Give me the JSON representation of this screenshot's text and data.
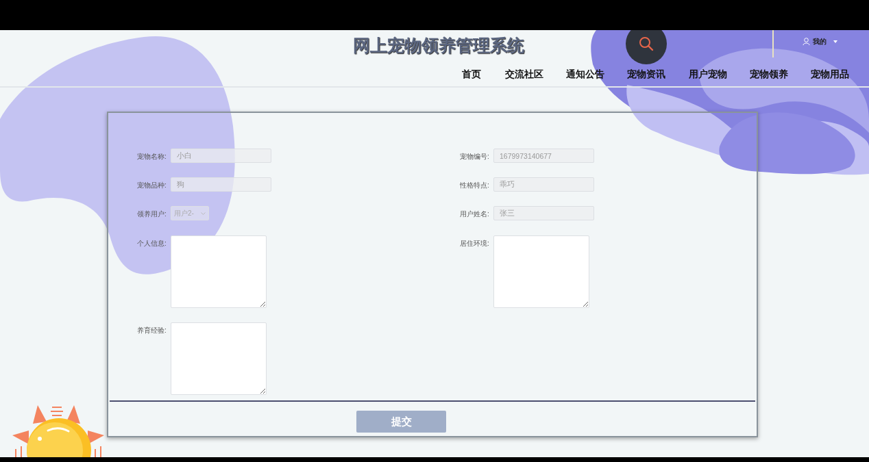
{
  "header": {
    "title": "网上宠物领养管理系统",
    "user_menu": "我的"
  },
  "nav": [
    {
      "label": "首页"
    },
    {
      "label": "交流社区"
    },
    {
      "label": "通知公告"
    },
    {
      "label": "宠物资讯"
    },
    {
      "label": "用户宠物"
    },
    {
      "label": "宠物领养"
    },
    {
      "label": "宠物用品"
    }
  ],
  "form": {
    "fields": [
      {
        "label": "宠物名称:",
        "kind": "text",
        "value": "小白",
        "disabled": true
      },
      {
        "label": "宠物编号:",
        "kind": "text",
        "value": "1679973140677",
        "disabled": true
      },
      {
        "label": "宠物品种:",
        "kind": "text",
        "value": "狗",
        "disabled": true
      },
      {
        "label": "性格特点:",
        "kind": "text",
        "value": "乖巧",
        "disabled": true
      },
      {
        "label": "领养用户:",
        "kind": "select",
        "value": "用户2-",
        "disabled": true
      },
      {
        "label": "用户姓名:",
        "kind": "text",
        "value": "张三",
        "disabled": true
      },
      {
        "label": "个人信息:",
        "kind": "textarea",
        "disabled": false
      },
      {
        "label": "居住环境:",
        "kind": "textarea",
        "disabled": false
      },
      {
        "label": "养育经验:",
        "kind": "textarea",
        "disabled": false
      }
    ],
    "submit": "提交"
  }
}
